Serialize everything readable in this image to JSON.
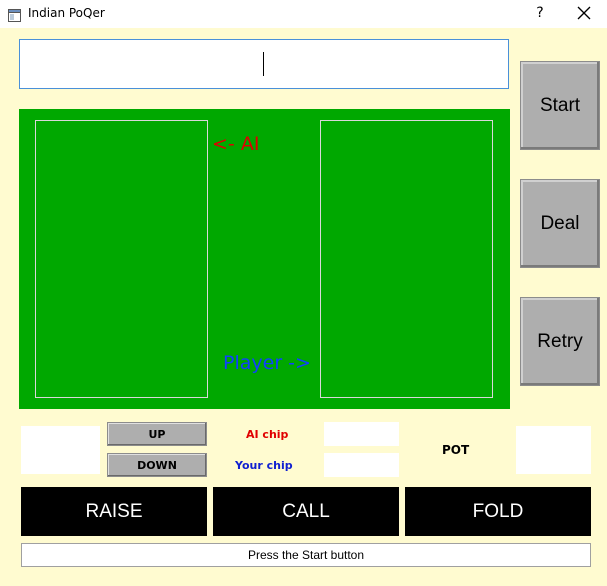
{
  "window": {
    "title": "Indian PoQer",
    "help": "?",
    "icon": "app-window-icon"
  },
  "message": {
    "value": ""
  },
  "table": {
    "ai_label": "<- AI",
    "player_label": "Player ->",
    "colors": {
      "felt": "#00a800",
      "ai": "#e00000",
      "player": "#1040ff"
    }
  },
  "controls": {
    "start": "Start",
    "deal": "Deal",
    "retry": "Retry"
  },
  "bet": {
    "up": "UP",
    "down": "DOWN",
    "ai_chip_label": "AI chip",
    "your_chip_label": "Your chip",
    "pot_label": "POT",
    "bet_value": "",
    "ai_chip_value": "",
    "your_chip_value": "",
    "pot_value": ""
  },
  "actions": {
    "raise": "RAISE",
    "call": "CALL",
    "fold": "FOLD"
  },
  "status": {
    "text": "Press the Start button"
  }
}
